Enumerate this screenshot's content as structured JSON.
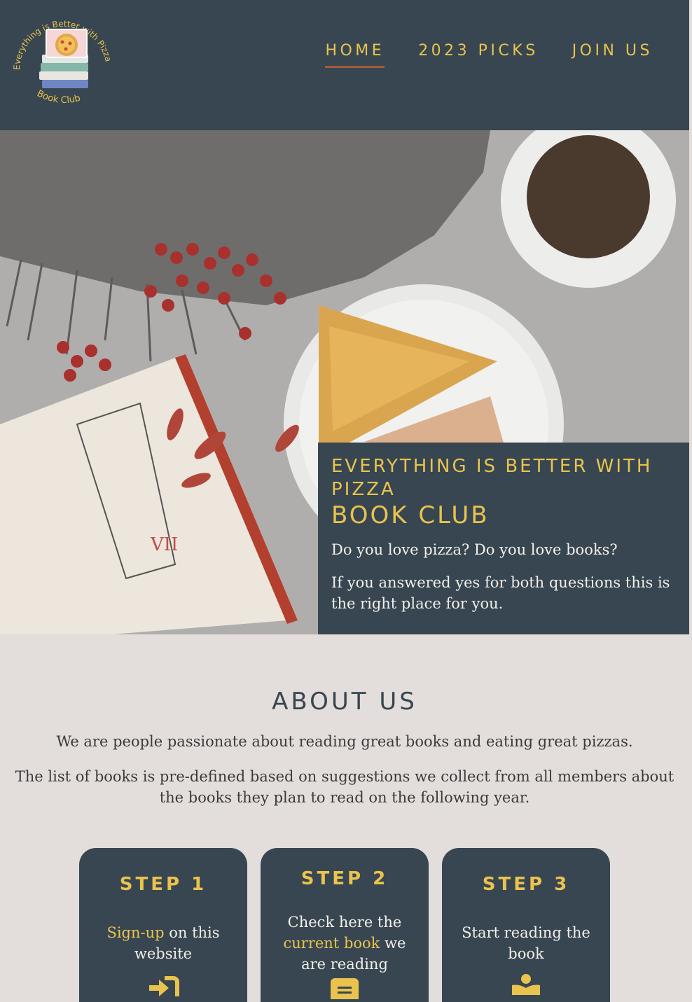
{
  "logo": {
    "arc_text": "Everything is Better with Pizza",
    "bottom_text": "Book Club"
  },
  "nav": {
    "items": [
      {
        "label": "HOME"
      },
      {
        "label": "2023 PICKS"
      },
      {
        "label": "JOIN US"
      }
    ]
  },
  "hero": {
    "title": "EVERYTHING IS BETTER WITH PIZZA",
    "subtitle": "BOOK CLUB",
    "paragraph_1": "Do you love pizza? Do you love books?",
    "paragraph_2": "If you answered yes for both questions this is the right place for you."
  },
  "about": {
    "title": "ABOUT US",
    "paragraph_1": "We are people passionate about reading great books and eating great pizzas.",
    "paragraph_2": "The list of books is pre-defined based on suggestions we collect from all members about the books they plan to read on the following year."
  },
  "steps": [
    {
      "title": "STEP 1",
      "highlight": "Sign-up",
      "text_after": " on this website",
      "icon": "sign-in-icon"
    },
    {
      "title": "STEP 2",
      "text_before": "Check here the ",
      "highlight": "current book",
      "text_after": " we are reading",
      "icon": "book-icon"
    },
    {
      "title": "STEP 3",
      "text": "Start reading the book",
      "icon": "reader-icon"
    }
  ],
  "colors": {
    "navy": "#374651",
    "gold": "#e9c34e",
    "background": "#e3dedb",
    "underline": "#a55a3b"
  }
}
